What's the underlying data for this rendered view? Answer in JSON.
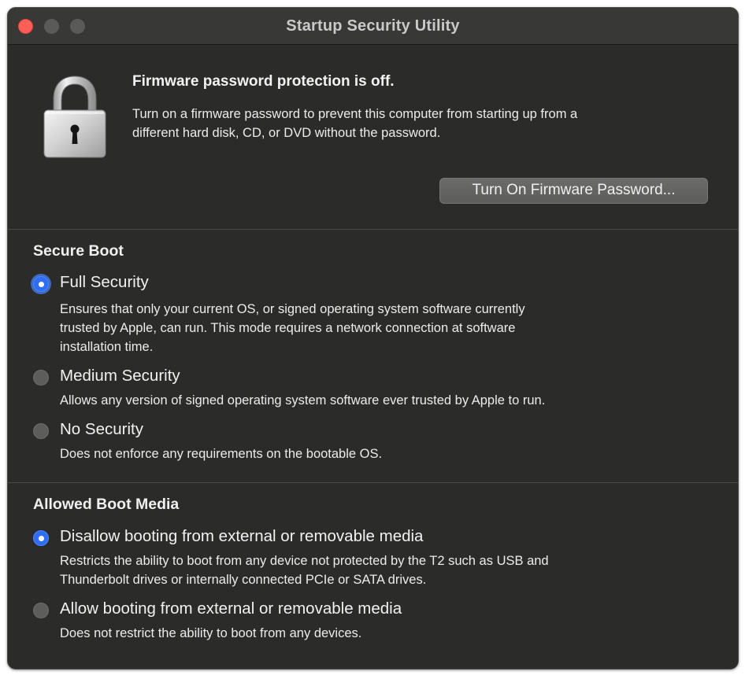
{
  "window": {
    "title": "Startup Security Utility"
  },
  "firmware": {
    "heading": "Firmware password protection is off.",
    "description_line1": "Turn on a firmware password to prevent this computer from starting up from a",
    "description_line2": "different hard disk, CD, or DVD without the password.",
    "button_label": "Turn On Firmware Password..."
  },
  "secure_boot": {
    "heading": "Secure Boot",
    "selected": "full",
    "options": [
      {
        "id": "full",
        "label": "Full Security",
        "description_lines": [
          "Ensures that only your current OS, or signed operating system software currently",
          "trusted by Apple, can run. This mode requires a network connection at software",
          "installation time."
        ]
      },
      {
        "id": "medium",
        "label": "Medium Security",
        "description_lines": [
          "Allows any version of signed operating system software ever trusted by Apple to run."
        ]
      },
      {
        "id": "none",
        "label": "No Security",
        "description_lines": [
          "Does not enforce any requirements on the bootable OS."
        ]
      }
    ]
  },
  "boot_media": {
    "heading": "Allowed Boot Media",
    "selected": "disallow",
    "options": [
      {
        "id": "disallow",
        "label": "Disallow booting from external or removable media",
        "description_lines": [
          "Restricts the ability to boot from any device not protected by the T2 such as USB and",
          "Thunderbolt drives or internally connected PCIe or SATA drives."
        ]
      },
      {
        "id": "allow",
        "label": "Allow booting from external or removable media",
        "description_lines": [
          "Does not restrict the ability to boot from any devices."
        ]
      }
    ]
  },
  "colors": {
    "window_background": "#2b2b2a",
    "titlebar": "#383837",
    "close_button": "#ff5f57",
    "radio_selected": "#2f6ef0",
    "button": "#636362"
  },
  "icons": {
    "lock": "padlock-icon"
  }
}
